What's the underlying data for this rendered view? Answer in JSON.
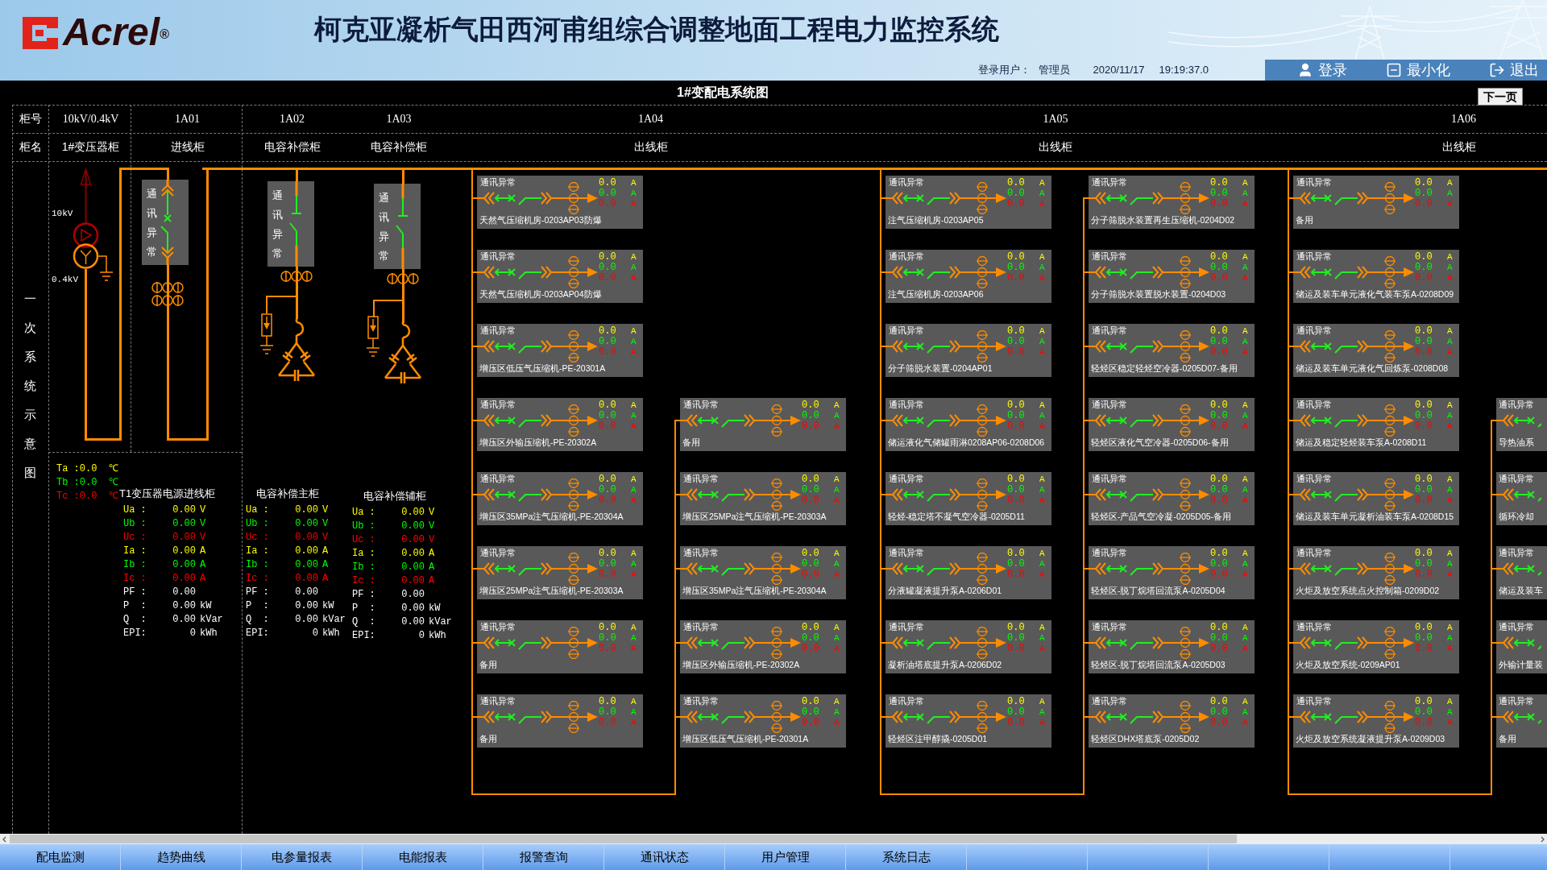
{
  "header": {
    "logo": "Acrel$^{®}$",
    "title": "柯克亚凝析气田西河甫组综合调整地面工程电力监控系统",
    "user_label": "登录用户：",
    "user": "管理员",
    "date": "2020/11/17",
    "time": "19:19:37.0",
    "actions": [
      {
        "kind": "login",
        "label": "登录"
      },
      {
        "kind": "minimize",
        "label": "最小化"
      },
      {
        "kind": "exit",
        "label": "退出"
      }
    ]
  },
  "diagram_title": "1#变配电系统图",
  "next_button": "下一页",
  "cabinet_table": {
    "row_labels": [
      "柜号",
      "柜名"
    ],
    "columns": [
      {
        "number": "10kV/0.4kV",
        "name": "1#变压器柜"
      },
      {
        "number": "1A01",
        "name": "进线柜"
      },
      {
        "number": "1A02",
        "name": "电容补偿柜"
      },
      {
        "number": "1A03",
        "name": "电容补偿柜"
      },
      {
        "number": "1A04",
        "name": "出线柜"
      },
      {
        "number": "1A05",
        "name": "出线柜"
      },
      {
        "number": "1A06",
        "name": "出线柜"
      }
    ]
  },
  "side_label": "一次系统示意图",
  "transformer": {
    "hv_label": "10kV",
    "lv_label": "0.4kV"
  },
  "incoming": {
    "status": "通讯异常"
  },
  "capacitor_cabinets": [
    {
      "status": "通讯异常"
    },
    {
      "status": "通讯异常"
    }
  ],
  "temperatures": [
    {
      "text": "Ta :0.0",
      "unit": "℃",
      "color": "#ffff00"
    },
    {
      "text": "Tb :0.0",
      "unit": "℃",
      "color": "#00ff00"
    },
    {
      "text": "Tc :0.0",
      "unit": "℃",
      "color": "#ff0000"
    }
  ],
  "meters": [
    {
      "title": "T1变压器电源进线柜",
      "rows": [
        {
          "label": "Ua :",
          "value": "0.00",
          "unit": "V",
          "color": "#ffff00"
        },
        {
          "label": "Ub :",
          "value": "0.00",
          "unit": "V",
          "color": "#00ff00"
        },
        {
          "label": "Uc :",
          "value": "0.00",
          "unit": "V",
          "color": "#ff0000"
        },
        {
          "label": "Ia :",
          "value": "0.00",
          "unit": "A",
          "color": "#ffff00"
        },
        {
          "label": "Ib :",
          "value": "0.00",
          "unit": "A",
          "color": "#00ff00"
        },
        {
          "label": "Ic :",
          "value": "0.00",
          "unit": "A",
          "color": "#ff0000"
        },
        {
          "label": "PF :",
          "value": "0.00",
          "color": "#ffffff"
        },
        {
          "label": "P  :",
          "value": "0.00",
          "unit": "kW",
          "color": "#ffffff"
        },
        {
          "label": "Q  :",
          "value": "0.00",
          "unit": "kVar",
          "color": "#ffffff"
        },
        {
          "label": "EPI:",
          "value": "0",
          "unit": "kWh",
          "color": "#ffffff"
        }
      ]
    },
    {
      "title": "电容补偿主柜",
      "rows": [
        {
          "label": "Ua :",
          "value": "0.00",
          "unit": "V",
          "color": "#ffff00"
        },
        {
          "label": "Ub :",
          "value": "0.00",
          "unit": "V",
          "color": "#00ff00"
        },
        {
          "label": "Uc :",
          "value": "0.00",
          "unit": "V",
          "color": "#ff0000"
        },
        {
          "label": "Ia :",
          "value": "0.00",
          "unit": "A",
          "color": "#ffff00"
        },
        {
          "label": "Ib :",
          "value": "0.00",
          "unit": "A",
          "color": "#00ff00"
        },
        {
          "label": "Ic :",
          "value": "0.00",
          "unit": "A",
          "color": "#ff0000"
        },
        {
          "label": "PF :",
          "value": "0.00",
          "color": "#ffffff"
        },
        {
          "label": "P  :",
          "value": "0.00",
          "unit": "kW",
          "color": "#ffffff"
        },
        {
          "label": "Q  :",
          "value": "0.00",
          "unit": "kVar",
          "color": "#ffffff"
        },
        {
          "label": "EPI:",
          "value": "0",
          "unit": "kWh",
          "color": "#ffffff"
        }
      ]
    },
    {
      "title": "电容补偿辅柜",
      "rows": [
        {
          "label": "Ua :",
          "value": "0.00",
          "unit": "V",
          "color": "#ffff00"
        },
        {
          "label": "Ub :",
          "value": "0.00",
          "unit": "V",
          "color": "#00ff00"
        },
        {
          "label": "Uc :",
          "value": "0.00",
          "unit": "V",
          "color": "#ff0000"
        },
        {
          "label": "Ia :",
          "value": "0.00",
          "unit": "A",
          "color": "#ffff00"
        },
        {
          "label": "Ib :",
          "value": "0.00",
          "unit": "A",
          "color": "#00ff00"
        },
        {
          "label": "Ic :",
          "value": "0.00",
          "unit": "A",
          "color": "#ff0000"
        },
        {
          "label": "PF :",
          "value": "0.00",
          "color": "#ffffff"
        },
        {
          "label": "P  :",
          "value": "0.00",
          "unit": "kW",
          "color": "#ffffff"
        },
        {
          "label": "Q  :",
          "value": "0.00",
          "unit": "kVar",
          "color": "#ffffff"
        },
        {
          "label": "EPI:",
          "value": "0",
          "unit": "kWh",
          "color": "#ffffff"
        }
      ]
    }
  ],
  "feeder_groups": [
    {
      "columns": [
        {
          "cards": [
            {
              "kind": "full",
              "status": "通讯异常",
              "name": "天然气压缩机房-0203AP03防爆",
              "readings": [
                {
                  "value": "0.0",
                  "unit": "A",
                  "color": "#ffff00"
                },
                {
                  "value": "0.0",
                  "unit": "A",
                  "color": "#00ff00"
                },
                {
                  "value": "0.0",
                  "unit": "A",
                  "color": "#ff0000"
                }
              ]
            },
            {
              "kind": "full",
              "status": "通讯异常",
              "name": "天然气压缩机房-0203AP04防爆",
              "readings": [
                {
                  "value": "0.0",
                  "unit": "A",
                  "color": "#ffff00"
                },
                {
                  "value": "0.0",
                  "unit": "A",
                  "color": "#00ff00"
                },
                {
                  "value": "0.0",
                  "unit": "A",
                  "color": "#ff0000"
                }
              ]
            },
            {
              "kind": "full",
              "status": "通讯异常",
              "name": "增压区低压气压缩机-PE-20301A",
              "readings": [
                {
                  "value": "0.0",
                  "unit": "A",
                  "color": "#ffff00"
                },
                {
                  "value": "0.0",
                  "unit": "A",
                  "color": "#00ff00"
                },
                {
                  "value": "0.0",
                  "unit": "A",
                  "color": "#ff0000"
                }
              ]
            },
            {
              "kind": "full",
              "status": "通讯异常",
              "name": "增压区外输压缩机-PE-20302A",
              "readings": [
                {
                  "value": "0.0",
                  "unit": "A",
                  "color": "#ffff00"
                },
                {
                  "value": "0.0",
                  "unit": "A",
                  "color": "#00ff00"
                },
                {
                  "value": "0.0",
                  "unit": "A",
                  "color": "#ff0000"
                }
              ]
            },
            {
              "kind": "full",
              "status": "通讯异常",
              "name": "增压区35MPa注气压缩机-PE-20304A",
              "readings": [
                {
                  "value": "0.0",
                  "unit": "A",
                  "color": "#ffff00"
                },
                {
                  "value": "0.0",
                  "unit": "A",
                  "color": "#00ff00"
                },
                {
                  "value": "0.0",
                  "unit": "A",
                  "color": "#ff0000"
                }
              ]
            },
            {
              "kind": "full",
              "status": "通讯异常",
              "name": "增压区25MPa注气压缩机-PE-20303A",
              "readings": [
                {
                  "value": "0.0",
                  "unit": "A",
                  "color": "#ffff00"
                },
                {
                  "value": "0.0",
                  "unit": "A",
                  "color": "#00ff00"
                },
                {
                  "value": "0.0",
                  "unit": "A",
                  "color": "#ff0000"
                }
              ]
            },
            {
              "kind": "full",
              "status": "通讯异常",
              "name": "备用",
              "readings": [
                {
                  "value": "0.0",
                  "unit": "A",
                  "color": "#ffff00"
                },
                {
                  "value": "0.0",
                  "unit": "A",
                  "color": "#00ff00"
                },
                {
                  "value": "0.0",
                  "unit": "A",
                  "color": "#ff0000"
                }
              ]
            },
            {
              "kind": "full",
              "status": "通讯异常",
              "name": "备用",
              "readings": [
                {
                  "value": "0.0",
                  "unit": "A",
                  "color": "#ffff00"
                },
                {
                  "value": "0.0",
                  "unit": "A",
                  "color": "#00ff00"
                },
                {
                  "value": "0.0",
                  "unit": "A",
                  "color": "#ff0000"
                }
              ]
            }
          ]
        },
        {
          "cards": [
            {
              "kind": "full",
              "status": "通讯异常",
              "name": "备用",
              "readings": [
                {
                  "value": "0.0",
                  "unit": "A",
                  "color": "#ffff00"
                },
                {
                  "value": "0.0",
                  "unit": "A",
                  "color": "#00ff00"
                },
                {
                  "value": "0.0",
                  "unit": "A",
                  "color": "#ff0000"
                }
              ]
            },
            {
              "kind": "full",
              "status": "通讯异常",
              "name": "增压区25MPa注气压缩机-PE-20303A",
              "readings": [
                {
                  "value": "0.0",
                  "unit": "A",
                  "color": "#ffff00"
                },
                {
                  "value": "0.0",
                  "unit": "A",
                  "color": "#00ff00"
                },
                {
                  "value": "0.0",
                  "unit": "A",
                  "color": "#ff0000"
                }
              ]
            },
            {
              "kind": "full",
              "status": "通讯异常",
              "name": "增压区35MPa注气压缩机-PE-20304A",
              "readings": [
                {
                  "value": "0.0",
                  "unit": "A",
                  "color": "#ffff00"
                },
                {
                  "value": "0.0",
                  "unit": "A",
                  "color": "#00ff00"
                },
                {
                  "value": "0.0",
                  "unit": "A",
                  "color": "#ff0000"
                }
              ]
            },
            {
              "kind": "full",
              "status": "通讯异常",
              "name": "增压区外输压缩机-PE-20302A",
              "readings": [
                {
                  "value": "0.0",
                  "unit": "A",
                  "color": "#ffff00"
                },
                {
                  "value": "0.0",
                  "unit": "A",
                  "color": "#00ff00"
                },
                {
                  "value": "0.0",
                  "unit": "A",
                  "color": "#ff0000"
                }
              ]
            },
            {
              "kind": "full",
              "status": "通讯异常",
              "name": "增压区低压气压缩机-PE-20301A",
              "readings": [
                {
                  "value": "0.0",
                  "unit": "A",
                  "color": "#ffff00"
                },
                {
                  "value": "0.0",
                  "unit": "A",
                  "color": "#00ff00"
                },
                {
                  "value": "0.0",
                  "unit": "A",
                  "color": "#ff0000"
                }
              ]
            }
          ]
        }
      ]
    },
    {
      "columns": [
        {
          "cards": [
            {
              "kind": "full",
              "status": "通讯异常",
              "name": "注气压缩机房-0203AP05",
              "readings": [
                {
                  "value": "0.0",
                  "unit": "A",
                  "color": "#ffff00"
                },
                {
                  "value": "0.0",
                  "unit": "A",
                  "color": "#00ff00"
                },
                {
                  "value": "0.0",
                  "unit": "A",
                  "color": "#ff0000"
                }
              ]
            },
            {
              "kind": "full",
              "status": "通讯异常",
              "name": "注气压缩机房-0203AP06",
              "readings": [
                {
                  "value": "0.0",
                  "unit": "A",
                  "color": "#ffff00"
                },
                {
                  "value": "0.0",
                  "unit": "A",
                  "color": "#00ff00"
                },
                {
                  "value": "0.0",
                  "unit": "A",
                  "color": "#ff0000"
                }
              ]
            },
            {
              "kind": "full",
              "status": "通讯异常",
              "name": "分子筛脱水装置-0204AP01",
              "readings": [
                {
                  "value": "0.0",
                  "unit": "A",
                  "color": "#ffff00"
                },
                {
                  "value": "0.0",
                  "unit": "A",
                  "color": "#00ff00"
                },
                {
                  "value": "0.0",
                  "unit": "A",
                  "color": "#ff0000"
                }
              ]
            },
            {
              "kind": "full",
              "status": "通讯异常",
              "name": "储运液化气储罐雨淋0208AP06-0208D06",
              "readings": [
                {
                  "value": "0.0",
                  "unit": "A",
                  "color": "#ffff00"
                },
                {
                  "value": "0.0",
                  "unit": "A",
                  "color": "#00ff00"
                },
                {
                  "value": "0.0",
                  "unit": "A",
                  "color": "#ff0000"
                }
              ]
            },
            {
              "kind": "full",
              "status": "通讯异常",
              "name": "轻烃-稳定塔不凝气空冷器-0205D11",
              "readings": [
                {
                  "value": "0.0",
                  "unit": "A",
                  "color": "#ffff00"
                },
                {
                  "value": "0.0",
                  "unit": "A",
                  "color": "#00ff00"
                },
                {
                  "value": "0.0",
                  "unit": "A",
                  "color": "#ff0000"
                }
              ]
            },
            {
              "kind": "full",
              "status": "通讯异常",
              "name": "分液罐凝液提升泵A-0206D01",
              "readings": [
                {
                  "value": "0.0",
                  "unit": "A",
                  "color": "#ffff00"
                },
                {
                  "value": "0.0",
                  "unit": "A",
                  "color": "#00ff00"
                },
                {
                  "value": "0.0",
                  "unit": "A",
                  "color": "#ff0000"
                }
              ]
            },
            {
              "kind": "full",
              "status": "通讯异常",
              "name": "凝析油塔底提升泵A-0206D02",
              "readings": [
                {
                  "value": "0.0",
                  "unit": "A",
                  "color": "#ffff00"
                },
                {
                  "value": "0.0",
                  "unit": "A",
                  "color": "#00ff00"
                },
                {
                  "value": "0.0",
                  "unit": "A",
                  "color": "#ff0000"
                }
              ]
            },
            {
              "kind": "full",
              "status": "通讯异常",
              "name": "轻烃区注甲醇撬-0205D01",
              "readings": [
                {
                  "value": "0.0",
                  "unit": "A",
                  "color": "#ffff00"
                },
                {
                  "value": "0.0",
                  "unit": "A",
                  "color": "#00ff00"
                },
                {
                  "value": "0.0",
                  "unit": "A",
                  "color": "#ff0000"
                }
              ]
            }
          ]
        },
        {
          "cards": [
            {
              "kind": "full",
              "status": "通讯异常",
              "name": "分子筛脱水装置再生压缩机-0204D02",
              "readings": [
                {
                  "value": "0.0",
                  "unit": "A",
                  "color": "#ffff00"
                },
                {
                  "value": "0.0",
                  "unit": "A",
                  "color": "#00ff00"
                },
                {
                  "value": "0.0",
                  "unit": "A",
                  "color": "#ff0000"
                }
              ]
            },
            {
              "kind": "full",
              "status": "通讯异常",
              "name": "分子筛脱水装置脱水装置-0204D03",
              "readings": [
                {
                  "value": "0.0",
                  "unit": "A",
                  "color": "#ffff00"
                },
                {
                  "value": "0.0",
                  "unit": "A",
                  "color": "#00ff00"
                },
                {
                  "value": "0.0",
                  "unit": "A",
                  "color": "#ff0000"
                }
              ]
            },
            {
              "kind": "full",
              "status": "通讯异常",
              "name": "轻烃区稳定轻烃空冷器-0205D07-备用",
              "readings": [
                {
                  "value": "0.0",
                  "unit": "A",
                  "color": "#ffff00"
                },
                {
                  "value": "0.0",
                  "unit": "A",
                  "color": "#00ff00"
                },
                {
                  "value": "0.0",
                  "unit": "A",
                  "color": "#ff0000"
                }
              ]
            },
            {
              "kind": "full",
              "status": "通讯异常",
              "name": "轻烃区液化气空冷器-0205D06-备用",
              "readings": [
                {
                  "value": "0.0",
                  "unit": "A",
                  "color": "#ffff00"
                },
                {
                  "value": "0.0",
                  "unit": "A",
                  "color": "#00ff00"
                },
                {
                  "value": "0.0",
                  "unit": "A",
                  "color": "#ff0000"
                }
              ]
            },
            {
              "kind": "full",
              "status": "通讯异常",
              "name": "轻烃区-产品气空冷凝-0205D05-备用",
              "readings": [
                {
                  "value": "0.0",
                  "unit": "A",
                  "color": "#ffff00"
                },
                {
                  "value": "0.0",
                  "unit": "A",
                  "color": "#00ff00"
                },
                {
                  "value": "0.0",
                  "unit": "A",
                  "color": "#ff0000"
                }
              ]
            },
            {
              "kind": "full",
              "status": "通讯异常",
              "name": "轻烃区-脱丁烷塔回流泵A-0205D04",
              "readings": [
                {
                  "value": "0.0",
                  "unit": "A",
                  "color": "#ffff00"
                },
                {
                  "value": "0.0",
                  "unit": "A",
                  "color": "#00ff00"
                },
                {
                  "value": "0.0",
                  "unit": "A",
                  "color": "#ff0000"
                }
              ]
            },
            {
              "kind": "full",
              "status": "通讯异常",
              "name": "轻烃区-脱丁烷塔回流泵A-0205D03",
              "readings": [
                {
                  "value": "0.0",
                  "unit": "A",
                  "color": "#ffff00"
                },
                {
                  "value": "0.0",
                  "unit": "A",
                  "color": "#00ff00"
                },
                {
                  "value": "0.0",
                  "unit": "A",
                  "color": "#ff0000"
                }
              ]
            },
            {
              "kind": "full",
              "status": "通讯异常",
              "name": "轻烃区DHX塔底泵-0205D02",
              "readings": [
                {
                  "value": "0.0",
                  "unit": "A",
                  "color": "#ffff00"
                },
                {
                  "value": "0.0",
                  "unit": "A",
                  "color": "#00ff00"
                },
                {
                  "value": "0.0",
                  "unit": "A",
                  "color": "#ff0000"
                }
              ]
            }
          ]
        }
      ]
    },
    {
      "columns": [
        {
          "cards": [
            {
              "kind": "full",
              "status": "通讯异常",
              "name": "备用",
              "readings": [
                {
                  "value": "0.0",
                  "unit": "A",
                  "color": "#ffff00"
                },
                {
                  "value": "0.0",
                  "unit": "A",
                  "color": "#00ff00"
                },
                {
                  "value": "0.0",
                  "unit": "A",
                  "color": "#ff0000"
                }
              ]
            },
            {
              "kind": "full",
              "status": "通讯异常",
              "name": "储运及装车单元液化气装车泵A-0208D09",
              "readings": [
                {
                  "value": "0.0",
                  "unit": "A",
                  "color": "#ffff00"
                },
                {
                  "value": "0.0",
                  "unit": "A",
                  "color": "#00ff00"
                },
                {
                  "value": "0.0",
                  "unit": "A",
                  "color": "#ff0000"
                }
              ]
            },
            {
              "kind": "full",
              "status": "通讯异常",
              "name": "储运及装车单元液化气回炼泵-0208D08",
              "readings": [
                {
                  "value": "0.0",
                  "unit": "A",
                  "color": "#ffff00"
                },
                {
                  "value": "0.0",
                  "unit": "A",
                  "color": "#00ff00"
                },
                {
                  "value": "0.0",
                  "unit": "A",
                  "color": "#ff0000"
                }
              ]
            },
            {
              "kind": "full",
              "status": "通讯异常",
              "name": "储运及稳定轻烃装车泵A-0208D11",
              "readings": [
                {
                  "value": "0.0",
                  "unit": "A",
                  "color": "#ffff00"
                },
                {
                  "value": "0.0",
                  "unit": "A",
                  "color": "#00ff00"
                },
                {
                  "value": "0.0",
                  "unit": "A",
                  "color": "#ff0000"
                }
              ]
            },
            {
              "kind": "full",
              "status": "通讯异常",
              "name": "储运及装车单元凝析油装车泵A-0208D15",
              "readings": [
                {
                  "value": "0.0",
                  "unit": "A",
                  "color": "#ffff00"
                },
                {
                  "value": "0.0",
                  "unit": "A",
                  "color": "#00ff00"
                },
                {
                  "value": "0.0",
                  "unit": "A",
                  "color": "#ff0000"
                }
              ]
            },
            {
              "kind": "full",
              "status": "通讯异常",
              "name": "火炬及放空系统点火控制箱-0209D02",
              "readings": [
                {
                  "value": "0.0",
                  "unit": "A",
                  "color": "#ffff00"
                },
                {
                  "value": "0.0",
                  "unit": "A",
                  "color": "#00ff00"
                },
                {
                  "value": "0.0",
                  "unit": "A",
                  "color": "#ff0000"
                }
              ]
            },
            {
              "kind": "full",
              "status": "通讯异常",
              "name": "火炬及放空系统-0209AP01",
              "readings": [
                {
                  "value": "0.0",
                  "unit": "A",
                  "color": "#ffff00"
                },
                {
                  "value": "0.0",
                  "unit": "A",
                  "color": "#00ff00"
                },
                {
                  "value": "0.0",
                  "unit": "A",
                  "color": "#ff0000"
                }
              ]
            },
            {
              "kind": "full",
              "status": "通讯异常",
              "name": "火炬及放空系统凝液提升泵A-0209D03",
              "readings": [
                {
                  "value": "0.0",
                  "unit": "A",
                  "color": "#ffff00"
                },
                {
                  "value": "0.0",
                  "unit": "A",
                  "color": "#00ff00"
                },
                {
                  "value": "0.0",
                  "unit": "A",
                  "color": "#ff0000"
                }
              ]
            }
          ]
        },
        {
          "cards": [
            {
              "kind": "partial",
              "status": "通讯异常",
              "name": "导热油系"
            },
            {
              "kind": "partial",
              "status": "通讯异常",
              "name": "循环冷却"
            },
            {
              "kind": "partial",
              "status": "通讯异常",
              "name": "储运及装车"
            },
            {
              "kind": "partial",
              "status": "通讯异常",
              "name": "外输计量装"
            },
            {
              "kind": "partial",
              "status": "通讯异常",
              "name": "备用"
            }
          ]
        }
      ]
    }
  ],
  "tabs": [
    {
      "label": "配电监测",
      "selected": false
    },
    {
      "label": "趋势曲线",
      "selected": false
    },
    {
      "label": "电参量报表",
      "selected": false
    },
    {
      "label": "电能报表",
      "selected": false
    },
    {
      "label": "报警查询",
      "selected": false
    },
    {
      "label": "通讯状态",
      "selected": false
    },
    {
      "label": "用户管理",
      "selected": false
    },
    {
      "label": "系统日志",
      "selected": false
    }
  ]
}
